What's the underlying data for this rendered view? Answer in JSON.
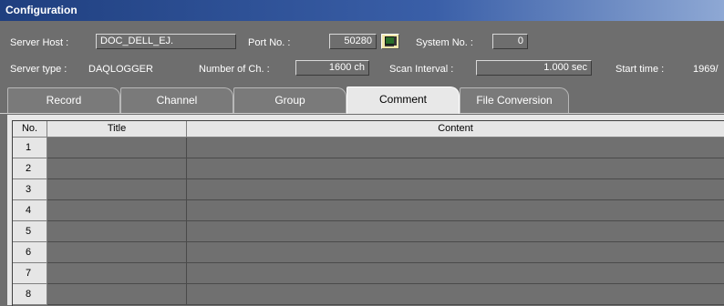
{
  "window": {
    "title": "Configuration"
  },
  "info": {
    "server_host_label": "Server Host :",
    "server_host_value": "DOC_DELL_EJ.",
    "port_label": "Port No. :",
    "port_value": "50280",
    "system_label": "System No. :",
    "system_value": "0",
    "server_type_label": "Server type :",
    "server_type_value": "DAQLOGGER",
    "channels_label": "Number of Ch. :",
    "channels_value": "1600 ch",
    "scan_label": "Scan Interval :",
    "scan_value": "1.000 sec",
    "start_label": "Start time :",
    "start_value": "1969/"
  },
  "icons": {
    "connect": "pc-connect-icon"
  },
  "tabs": [
    {
      "label": "Record"
    },
    {
      "label": "Channel"
    },
    {
      "label": "Group"
    },
    {
      "label": "Comment"
    },
    {
      "label": "File Conversion"
    }
  ],
  "active_tab": "Comment",
  "table": {
    "headers": {
      "no": "No.",
      "title": "Title",
      "content": "Content"
    },
    "rows": [
      {
        "no": "1",
        "title": "",
        "content": ""
      },
      {
        "no": "2",
        "title": "",
        "content": ""
      },
      {
        "no": "3",
        "title": "",
        "content": ""
      },
      {
        "no": "4",
        "title": "",
        "content": ""
      },
      {
        "no": "5",
        "title": "",
        "content": ""
      },
      {
        "no": "6",
        "title": "",
        "content": ""
      },
      {
        "no": "7",
        "title": "",
        "content": ""
      },
      {
        "no": "8",
        "title": "",
        "content": ""
      }
    ]
  }
}
